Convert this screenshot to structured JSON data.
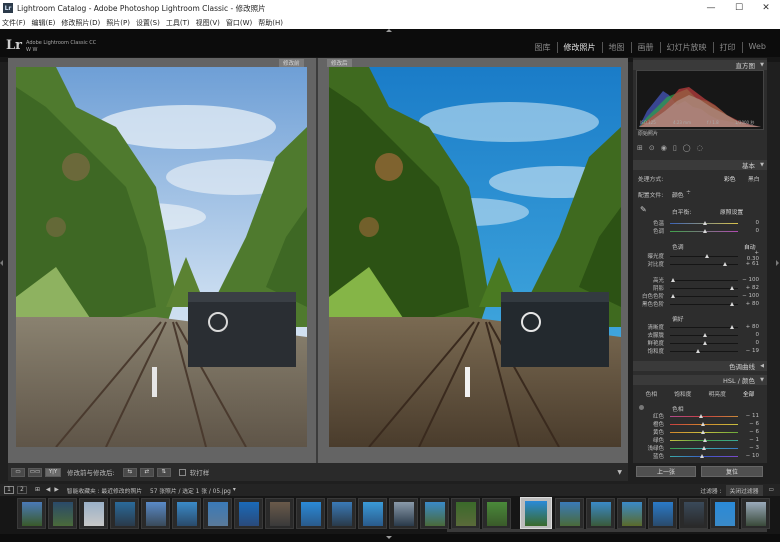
{
  "window": {
    "title": "Lightroom Catalog - Adobe Photoshop Lightroom Classic - 修改照片",
    "app_badge": "Lr",
    "controls": [
      "—",
      "☐",
      "✕"
    ]
  },
  "menu": [
    "文件(F)",
    "编辑(E)",
    "修改照片(D)",
    "照片(P)",
    "设置(S)",
    "工具(T)",
    "视图(V)",
    "窗口(W)",
    "帮助(H)"
  ],
  "identity": {
    "logo": "Lr",
    "product": "Adobe Lightroom Classic CC",
    "user": "W W"
  },
  "modules": [
    {
      "label": "图库",
      "active": false
    },
    {
      "label": "修改照片",
      "active": true
    },
    {
      "label": "地图",
      "active": false
    },
    {
      "label": "画册",
      "active": false
    },
    {
      "label": "幻灯片放映",
      "active": false
    },
    {
      "label": "打印",
      "active": false
    },
    {
      "label": "Web",
      "active": false
    }
  ],
  "viewer": {
    "before_label": "修改前",
    "after_label": "修改后"
  },
  "toolbar": {
    "view_mode": "Y|Y",
    "compare_label": "修改前与修改后:",
    "softproof_label": "软打样"
  },
  "right_panel": {
    "histogram_title": "直方图",
    "histo_info": [
      "ISO 125",
      "4.23 mm",
      "f / 1.8",
      "1/3000 秒"
    ],
    "original_photo": "原始照片",
    "basic_title": "基本",
    "treatment_label": "处理方式:",
    "treatment_color": "彩色",
    "treatment_bw": "黑白",
    "profile_label": "配置文件:",
    "profile_value": "颜色",
    "wb_label": "白平衡:",
    "wb_value": "原照设置",
    "tone_label": "色调",
    "auto_label": "自动",
    "presence_label": "偏好",
    "sliders_wb": [
      {
        "label": "色温",
        "value": "0",
        "pos": 0.5
      },
      {
        "label": "色调",
        "value": "0",
        "pos": 0.5
      }
    ],
    "sliders_tone": [
      {
        "label": "曝光度",
        "value": "+ 0.30",
        "pos": 0.53
      },
      {
        "label": "对比度",
        "value": "+ 61",
        "pos": 0.8
      },
      {
        "label": "高光",
        "value": "− 100",
        "pos": 0.02
      },
      {
        "label": "阴影",
        "value": "+ 82",
        "pos": 0.91
      },
      {
        "label": "白色色阶",
        "value": "− 100",
        "pos": 0.02
      },
      {
        "label": "黑色色阶",
        "value": "+ 80",
        "pos": 0.9
      }
    ],
    "sliders_presence": [
      {
        "label": "清晰度",
        "value": "+ 80",
        "pos": 0.9
      },
      {
        "label": "去朦胧",
        "value": "0",
        "pos": 0.5
      },
      {
        "label": "鲜艳度",
        "value": "0",
        "pos": 0.5
      },
      {
        "label": "饱和度",
        "value": "− 19",
        "pos": 0.4
      }
    ],
    "curve_title": "色调曲线",
    "hsl_title": "HSL / 颜色",
    "hsl_tabs": [
      "色相",
      "饱和度",
      "明亮度",
      "全部"
    ],
    "hsl_section": "色相",
    "sliders_hsl": [
      {
        "label": "红色",
        "value": "− 11",
        "pos": 0.44
      },
      {
        "label": "橙色",
        "value": "− 6",
        "pos": 0.47
      },
      {
        "label": "黄色",
        "value": "− 6",
        "pos": 0.47
      },
      {
        "label": "绿色",
        "value": "− 1",
        "pos": 0.5
      },
      {
        "label": "浅绿色",
        "value": "− 3",
        "pos": 0.49
      },
      {
        "label": "蓝色",
        "value": "− 10",
        "pos": 0.45
      }
    ],
    "prev_button": "上一张",
    "reset_button": "复位"
  },
  "filmstrip": {
    "page_numbers": [
      "1",
      "2"
    ],
    "source": "智能收藏夹 : 最近修改的照片",
    "count": "57 张照片 / 选定 1 张 / 05.jpg",
    "filter_label": "过滤器 :",
    "filter_value": "关闭过滤器"
  },
  "colors": {
    "panel_bg": "#2d2d2d",
    "viewer_bg": "#646464",
    "accent_text": "#e6e6e6"
  }
}
